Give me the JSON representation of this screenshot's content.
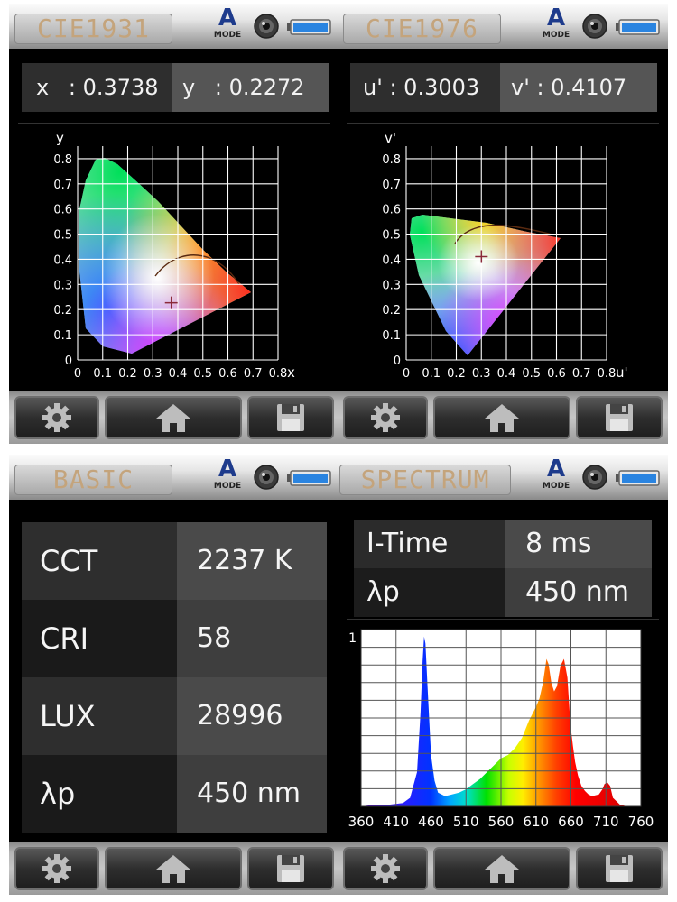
{
  "mode_icon": {
    "letter": "A",
    "caption": "MODE"
  },
  "cie1931": {
    "title": "CIE1931",
    "x_label": "x",
    "x_value": "0.3738",
    "y_label": "y",
    "y_value": "0.2272",
    "chart_data": {
      "type": "scatter",
      "xlabel": "x",
      "ylabel": "y",
      "xlim": [
        0,
        0.8
      ],
      "ylim": [
        0,
        0.85
      ],
      "x_ticks": [
        "0",
        "0.1",
        "0.2",
        "0.3",
        "0.4",
        "0.5",
        "0.6",
        "0.7",
        "0.8"
      ],
      "y_ticks": [
        "0",
        "0.1",
        "0.2",
        "0.3",
        "0.4",
        "0.5",
        "0.6",
        "0.7",
        "0.8"
      ],
      "point": {
        "x": 0.3738,
        "y": 0.2272
      },
      "grid": true
    }
  },
  "cie1976": {
    "title": "CIE1976",
    "u_label": "u'",
    "u_value": "0.3003",
    "v_label": "v'",
    "v_value": "0.4107",
    "chart_data": {
      "type": "scatter",
      "xlabel": "u'",
      "ylabel": "v'",
      "xlim": [
        0,
        0.8
      ],
      "ylim": [
        0,
        0.85
      ],
      "x_ticks": [
        "0",
        "0.1",
        "0.2",
        "0.3",
        "0.4",
        "0.5",
        "0.6",
        "0.7",
        "0.8"
      ],
      "y_ticks": [
        "0",
        "0.1",
        "0.2",
        "0.3",
        "0.4",
        "0.5",
        "0.6",
        "0.7",
        "0.8"
      ],
      "point": {
        "x": 0.3003,
        "y": 0.4107
      },
      "grid": true
    }
  },
  "basic": {
    "title": "BASIC",
    "rows": [
      {
        "key": "CCT",
        "value": "2237 K"
      },
      {
        "key": "CRI",
        "value": "58"
      },
      {
        "key": "LUX",
        "value": "28996"
      },
      {
        "key": "λp",
        "value": "450 nm"
      }
    ]
  },
  "spectrum": {
    "title": "SPECTRUM",
    "rows": [
      {
        "key": "I-Time",
        "value": "8 ms"
      },
      {
        "key": "λp",
        "value": "450 nm"
      }
    ],
    "chart_data": {
      "type": "area",
      "xlim": [
        360,
        760
      ],
      "ylim": [
        0,
        1
      ],
      "y_tick_label": "1",
      "x_ticks": [
        "360",
        "410",
        "460",
        "510",
        "560",
        "610",
        "660",
        "710",
        "760"
      ],
      "x": [
        360,
        380,
        400,
        420,
        430,
        440,
        445,
        448,
        450,
        452,
        455,
        460,
        465,
        470,
        480,
        490,
        500,
        510,
        520,
        530,
        540,
        550,
        560,
        570,
        580,
        590,
        600,
        610,
        615,
        620,
        625,
        628,
        632,
        636,
        640,
        645,
        650,
        655,
        658,
        660,
        663,
        666,
        670,
        675,
        680,
        685,
        690,
        700,
        705,
        708,
        712,
        716,
        720,
        730,
        740,
        760
      ],
      "values": [
        0,
        0.01,
        0.01,
        0.02,
        0.05,
        0.2,
        0.55,
        0.85,
        0.99,
        0.95,
        0.7,
        0.3,
        0.15,
        0.08,
        0.06,
        0.07,
        0.08,
        0.1,
        0.13,
        0.16,
        0.2,
        0.24,
        0.28,
        0.3,
        0.34,
        0.4,
        0.5,
        0.58,
        0.63,
        0.72,
        0.86,
        0.83,
        0.72,
        0.67,
        0.7,
        0.82,
        0.86,
        0.75,
        0.56,
        0.45,
        0.35,
        0.26,
        0.18,
        0.12,
        0.09,
        0.07,
        0.06,
        0.07,
        0.1,
        0.13,
        0.14,
        0.12,
        0.05,
        0.01,
        0,
        0
      ],
      "grid": true
    }
  },
  "colors": {
    "panel_bg": "#000000",
    "title_text": "#c4a47c",
    "value_cell": "#4a4a4a",
    "mode_blue": "#1e3b8c"
  }
}
